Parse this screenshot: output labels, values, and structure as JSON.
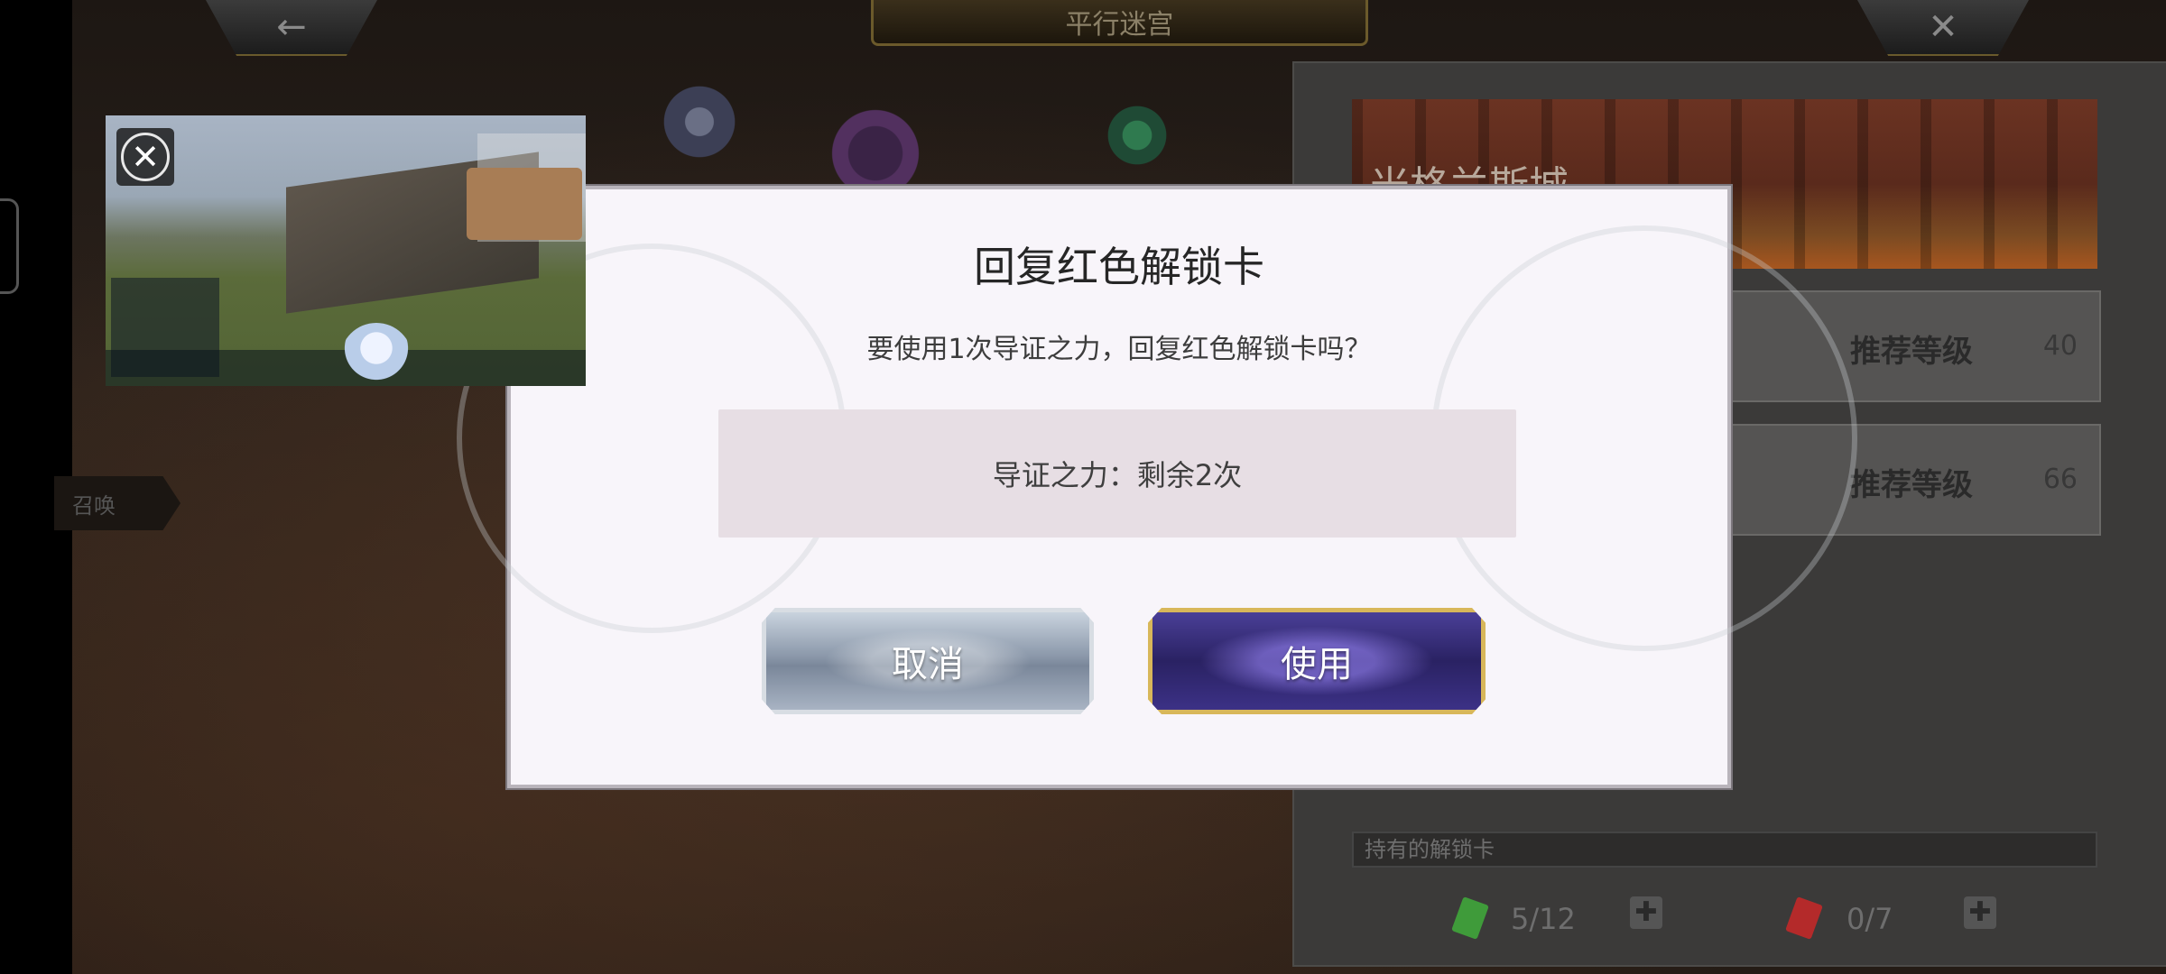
{
  "header": {
    "title": "平行迷宫",
    "back_icon": "←",
    "close_icon": "✕"
  },
  "side_tag": {
    "label": "召唤"
  },
  "right_panel": {
    "region_name": "米格兰斯城",
    "rows": [
      {
        "label": "推荐等级",
        "value": "40"
      },
      {
        "label": "推荐等级",
        "value": "66"
      }
    ],
    "owned_cards_label": "持有的解锁卡",
    "cards": [
      {
        "color": "#3f9b3a",
        "count": "5/12"
      },
      {
        "color": "#b42a2a",
        "count": "0/7"
      }
    ],
    "plus_label": "✚"
  },
  "pip": {
    "close_symbol": "✕"
  },
  "dialog": {
    "title": "回复红色解锁卡",
    "message": "要使用1次导证之力，回复红色解锁卡吗？",
    "status": "导证之力：剩余2次",
    "cancel_label": "取消",
    "use_label": "使用"
  }
}
